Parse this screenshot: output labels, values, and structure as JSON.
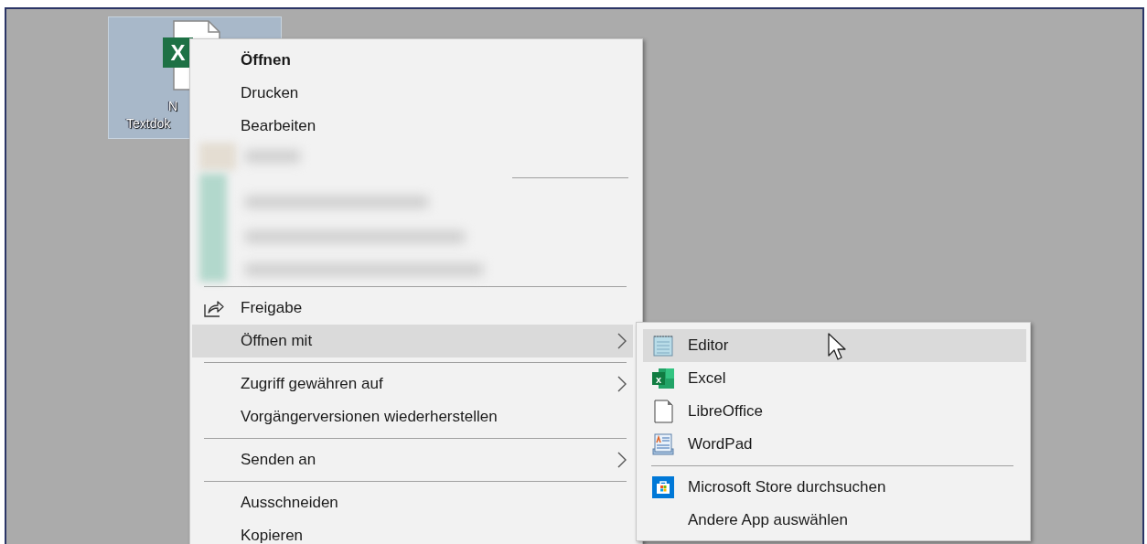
{
  "desktop_icon": {
    "selected": true,
    "logo_letter": "X",
    "label_lines": [
      "N",
      "Textdok"
    ]
  },
  "context_menu": {
    "items": [
      {
        "kind": "item",
        "label": "Öffnen",
        "default": true,
        "selected": false
      },
      {
        "kind": "item",
        "label": "Drucken",
        "default": false,
        "selected": false
      },
      {
        "kind": "item",
        "label": "Bearbeiten",
        "default": false,
        "selected": false
      },
      {
        "kind": "blurred"
      },
      {
        "kind": "separator"
      },
      {
        "kind": "share",
        "label": "Freigabe",
        "default": false,
        "selected": false
      },
      {
        "kind": "submenu",
        "label": "Öffnen mit",
        "default": false,
        "selected": true
      },
      {
        "kind": "separator"
      },
      {
        "kind": "submenu",
        "label": "Zugriff gewähren auf",
        "default": false,
        "selected": false
      },
      {
        "kind": "item",
        "label": "Vorgängerversionen wiederherstellen",
        "default": false,
        "selected": false
      },
      {
        "kind": "separator"
      },
      {
        "kind": "submenu",
        "label": "Senden an",
        "default": false,
        "selected": false
      },
      {
        "kind": "separator"
      },
      {
        "kind": "item",
        "label": "Ausschneiden",
        "default": false,
        "selected": false
      },
      {
        "kind": "item",
        "label": "Kopieren",
        "default": false,
        "selected": false
      }
    ]
  },
  "submenu": {
    "items": [
      {
        "kind": "notepad",
        "label": "Editor",
        "selected": true
      },
      {
        "kind": "excel",
        "label": "Excel",
        "logo_letter": "x",
        "selected": false
      },
      {
        "kind": "page",
        "label": "LibreOffice",
        "selected": false
      },
      {
        "kind": "wordpad",
        "label": "WordPad",
        "selected": false
      },
      {
        "kind": "separator"
      },
      {
        "kind": "store",
        "label": "Microsoft Store durchsuchen",
        "selected": false
      },
      {
        "kind": "plain",
        "label": "Andere App auswählen",
        "selected": false
      }
    ]
  }
}
